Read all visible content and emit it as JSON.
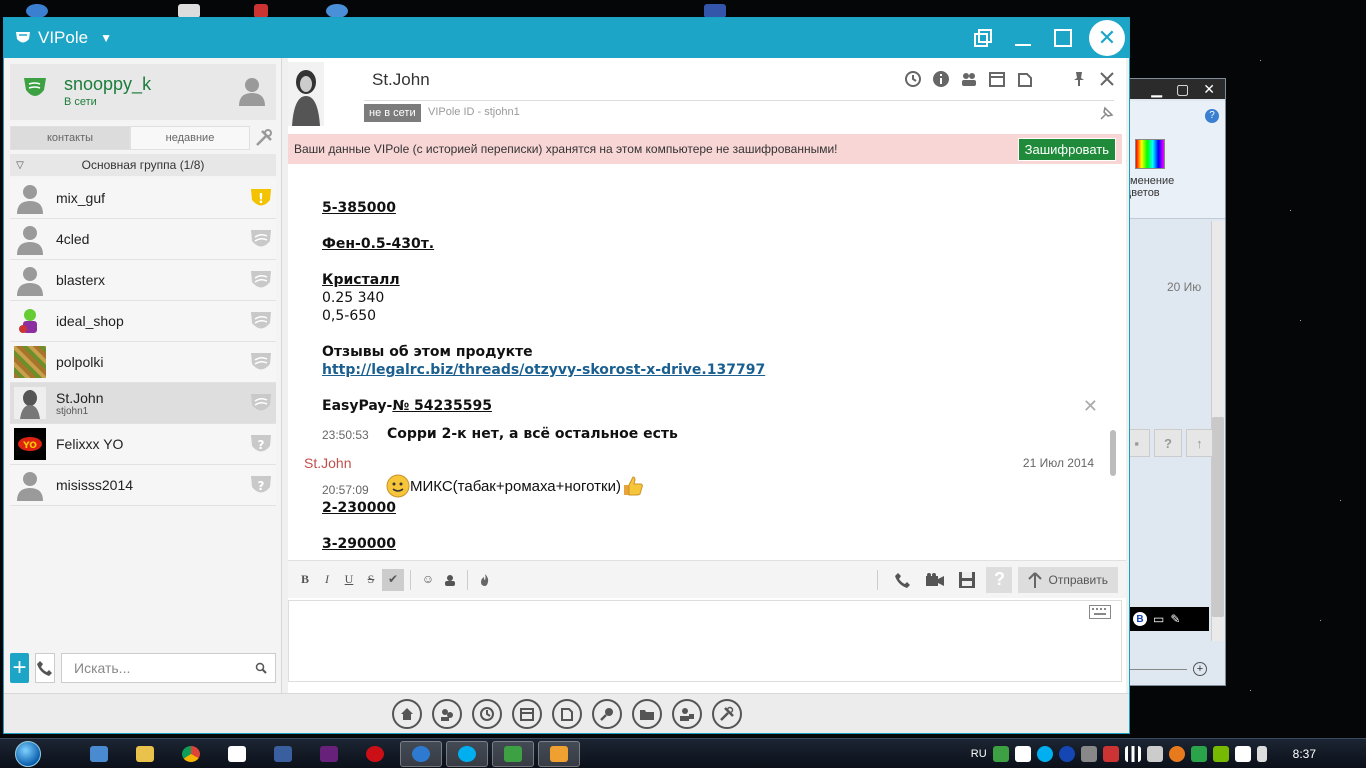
{
  "app": {
    "title": "VIPole",
    "brand_color": "#1da5c8"
  },
  "profile": {
    "name": "snooppy_k",
    "status": "В сети"
  },
  "contact_tabs": [
    "контакты",
    "недавние"
  ],
  "group": {
    "label": "Основная группа (1/8)"
  },
  "contacts": [
    {
      "name": "mix_guf",
      "sub": "",
      "badge": "warning-shield-icon",
      "avatar": "default-avatar-icon"
    },
    {
      "name": "4cled",
      "sub": "",
      "badge": "shield-icon",
      "avatar": "default-avatar-icon"
    },
    {
      "name": "blasterx",
      "sub": "",
      "badge": "shield-icon",
      "avatar": "default-avatar-icon"
    },
    {
      "name": "ideal_shop",
      "sub": "",
      "badge": "shield-icon",
      "avatar": "cartoon-avatar"
    },
    {
      "name": "polpolki",
      "sub": "",
      "badge": "shield-icon",
      "avatar": "pattern-avatar"
    },
    {
      "name": "St.John",
      "sub": "stjohn1",
      "badge": "shield-icon",
      "avatar": "photo-avatar"
    },
    {
      "name": "Felixxx YO",
      "sub": "",
      "badge": "question-shield-icon",
      "avatar": "logo-avatar"
    },
    {
      "name": "misisss2014",
      "sub": "",
      "badge": "question-shield-icon",
      "avatar": "default-avatar-icon"
    }
  ],
  "search": {
    "placeholder": "Искать..."
  },
  "chat": {
    "contact_name": "St.John",
    "status_badge": "не в сети",
    "vipole_id": "VIPole ID - stjohn1",
    "warning_text": "Ваши данные VIPole (с историей переписки) хранятся на этом компьютере не зашифрованными!",
    "encrypt_button": "Зашифровать",
    "messages": {
      "l1": "5-385000",
      "l2": "Фен-0.5-430т.",
      "l3": "Кристалл",
      "l4": "0.25 340",
      "l5": "0,5-650",
      "l6": "Отзывы об этом продукте",
      "l7": "http://legalrc.biz/threads/otzyvy-skorost-x-drive.137797",
      "l8a": "EasyPay-",
      "l8b": "№ 54235595",
      "t1": "23:50:53",
      "m1": "Сорри 2-к нет, а всё остальное есть",
      "sender": "St.John",
      "date": "21 Июл 2014",
      "t2": "20:57:09",
      "m2": "МИКС(табак+ромаха+ноготки)",
      "l9": "2-230000",
      "l10": "3-290000"
    },
    "format_buttons": [
      "B",
      "I",
      "U",
      "S"
    ],
    "send_button": "Отправить"
  },
  "background_window": {
    "ribbon_label_1": "зменение",
    "ribbon_label_2": "цветов",
    "date": "20 Ию"
  },
  "taskbar": {
    "language": "RU",
    "clock": "8:37"
  }
}
